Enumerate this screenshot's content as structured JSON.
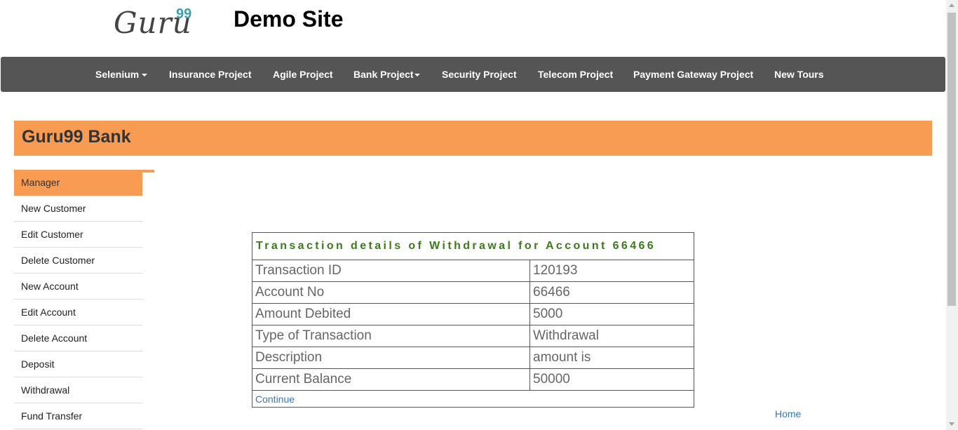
{
  "header": {
    "logo_text": "Guru",
    "logo_sup": "99",
    "site_title": "Demo Site"
  },
  "nav": {
    "items": [
      {
        "label": "Selenium",
        "dropdown": true
      },
      {
        "label": "Insurance Project",
        "dropdown": false
      },
      {
        "label": "Agile Project",
        "dropdown": false
      },
      {
        "label": "Bank Project",
        "dropdown": true
      },
      {
        "label": "Security Project",
        "dropdown": false
      },
      {
        "label": "Telecom Project",
        "dropdown": false
      },
      {
        "label": "Payment Gateway Project",
        "dropdown": false
      },
      {
        "label": "New Tours",
        "dropdown": false
      }
    ]
  },
  "bank": {
    "title": "Guru99 Bank"
  },
  "menu": {
    "items": [
      "Manager",
      "New Customer",
      "Edit Customer",
      "Delete Customer",
      "New Account",
      "Edit Account",
      "Delete Account",
      "Deposit",
      "Withdrawal",
      "Fund Transfer"
    ],
    "active": "Manager"
  },
  "transaction": {
    "heading": "Transaction details of Withdrawal for Account 66466",
    "rows": [
      {
        "label": "Transaction ID",
        "value": "120193"
      },
      {
        "label": "Account No",
        "value": "66466"
      },
      {
        "label": "Amount Debited",
        "value": "5000"
      },
      {
        "label": "Type of Transaction",
        "value": "Withdrawal"
      },
      {
        "label": "Description",
        "value": "amount is"
      },
      {
        "label": "Current Balance",
        "value": "50000"
      }
    ],
    "continue_label": "Continue"
  },
  "footer": {
    "home_label": "Home"
  },
  "colors": {
    "accent": "#f79c52",
    "navbar": "#555555",
    "heading_green": "#3d7a1f",
    "link": "#3a75b0"
  }
}
